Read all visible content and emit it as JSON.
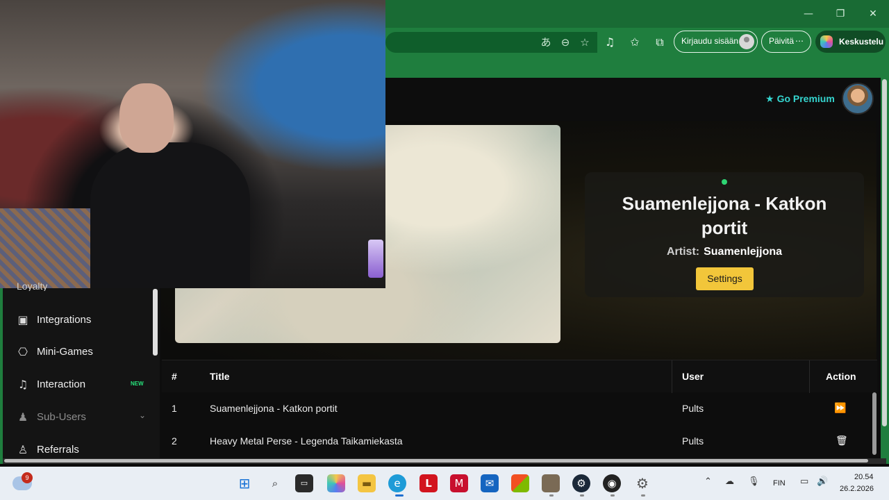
{
  "browser": {
    "sign_in_label": "Kirjaudu sisään",
    "update_label": "Päivitä",
    "update_more": "⋯",
    "copilot_label": "Keskustelu",
    "window_controls": {
      "minimize": "—",
      "restore": "❐",
      "close": "✕"
    }
  },
  "header": {
    "premium_label": "Go Premium",
    "premium_icon": "star-icon",
    "accent_color": "#35d6d0"
  },
  "now_playing": {
    "title": "Suamenlejjona - Katkon portit",
    "artist_label": "Artist:",
    "artist": "Suamenlejjona",
    "settings_label": "Settings",
    "live_color": "#2ed573",
    "button_color": "#f2c63a"
  },
  "sidebar": {
    "peek_label": "Loyalty",
    "items": [
      {
        "label": "Integrations",
        "icon": "discord-icon",
        "glyph": "▣"
      },
      {
        "label": "Mini-Games",
        "icon": "gamepad-icon",
        "glyph": "⎔"
      },
      {
        "label": "Interaction",
        "icon": "music-note-icon",
        "glyph": "♫",
        "badge": "NEW"
      },
      {
        "label": "Sub-Users",
        "icon": "users-icon",
        "glyph": "♟",
        "chevron": "⌄"
      },
      {
        "label": "Referrals",
        "icon": "user-group-icon",
        "glyph": "♙"
      }
    ]
  },
  "queue": {
    "columns": {
      "num": "#",
      "title": "Title",
      "user": "User",
      "action": "Action"
    },
    "rows": [
      {
        "num": "1",
        "title": "Suamenlejjona - Katkon portit",
        "user": "Pults",
        "action_icon": "skip-icon",
        "action_glyph": "⏩"
      },
      {
        "num": "2",
        "title": "Heavy Metal Perse - Legenda Taikamiekasta",
        "user": "Pults",
        "action_icon": "trash-icon",
        "action_glyph": "🗑"
      }
    ]
  },
  "taskbar": {
    "notification_count": "9",
    "language": "FIN",
    "time": "20.54",
    "date": "26.2.2026"
  }
}
